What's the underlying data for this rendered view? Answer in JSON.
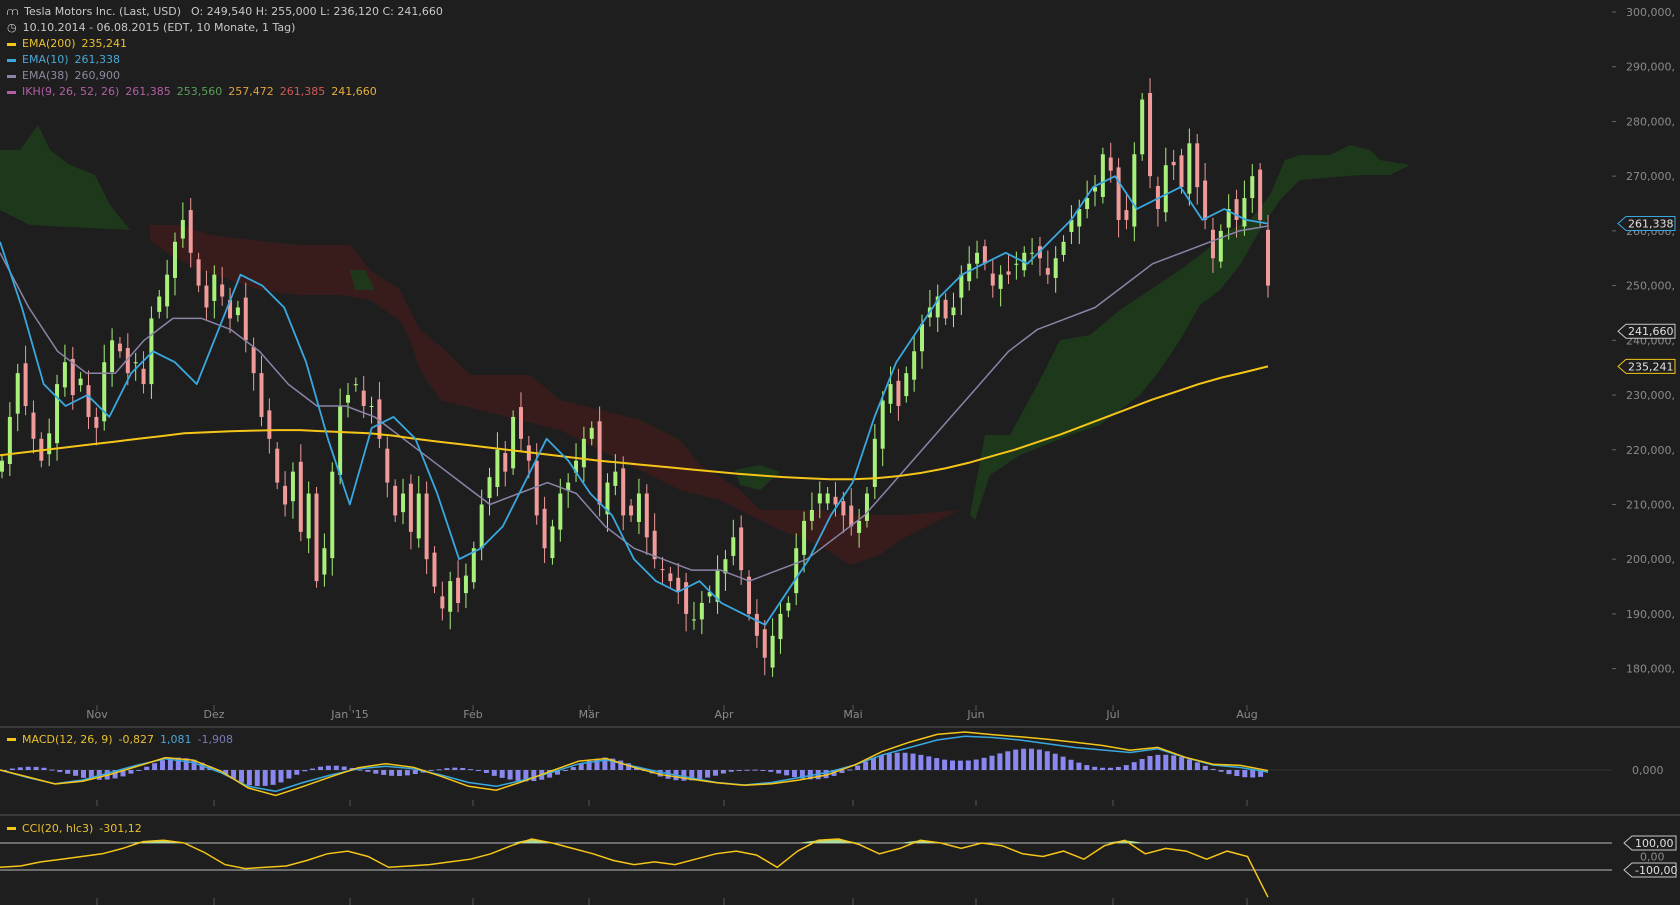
{
  "header": {
    "symbol": "Tesla Motors Inc. (Last, USD)",
    "ohlc": "O: 249,540   H: 255,000   L: 236,120   C: 241,660",
    "range": "10.10.2014 - 06.08.2015 (EDT, 10 Monate, 1 Tag)",
    "ema200": {
      "label": "EMA(200)",
      "value": "235,241"
    },
    "ema10": {
      "label": "EMA(10)",
      "value": "261,338"
    },
    "ema38": {
      "label": "EMA(38)",
      "value": "260,900"
    },
    "ikh": {
      "label": "IKH(9, 26, 52, 26)",
      "v1": "261,385",
      "v2": "253,560",
      "v3": "257,472",
      "v4": "261,385",
      "v5": "241,660"
    }
  },
  "macd_legend": {
    "label": "MACD(12, 26, 9)",
    "v1": "-0,827",
    "v2": "1,081",
    "v3": "-1,908"
  },
  "cci_legend": {
    "label": "CCI(20, hlc3)",
    "v1": "-301,12"
  },
  "colors": {
    "bg": "#1e1e1e",
    "grid": "#3a3a3a",
    "up": "#a8f07a",
    "down": "#f09a9a",
    "ema200": "#f5c518",
    "ema10": "#3aa8e0",
    "ema38": "#8a84a8",
    "cloud_green": "#1d3a1b",
    "cloud_red": "#3a1c1c",
    "macd_hist": "#8888ee",
    "cci_line": "#f5c518",
    "cci_up_fill": "#b9f0a0",
    "cci_down_fill": "#f0b0b0"
  },
  "chart_data": {
    "type": "line",
    "title": "Tesla Motors Inc. (Last, USD)",
    "x_tick_labels": [
      "Nov",
      "Dez",
      "Jan '15",
      "Feb",
      "Mär",
      "Apr",
      "Mai",
      "Jun",
      "Jul",
      "Aug"
    ],
    "y_tick_labels": [
      "300,000",
      "290,000",
      "280,000",
      "270,000",
      "260,000",
      "250,000",
      "240,000",
      "230,000",
      "220,000",
      "210,000",
      "200,000",
      "190,000",
      "180,000"
    ],
    "ylim": [
      175,
      300
    ],
    "price_tags": [
      {
        "label": "261,338",
        "value": 261.338,
        "color": "#3aa8e0"
      },
      {
        "label": "241,660",
        "value": 241.66,
        "color": "#c8c8c8"
      },
      {
        "label": "235,241",
        "value": 235.241,
        "color": "#f5c518"
      }
    ],
    "candles_close": [
      218,
      226,
      234,
      228,
      222,
      218,
      223,
      232,
      236,
      230,
      233,
      226,
      224,
      236,
      240,
      238,
      234,
      236,
      232,
      244,
      248,
      252,
      258,
      262,
      256,
      250,
      246,
      252,
      248,
      244,
      246,
      240,
      234,
      226,
      222,
      214,
      210,
      216,
      205,
      212,
      196,
      202,
      216,
      228,
      230,
      232,
      228,
      228,
      222,
      214,
      208,
      212,
      205,
      212,
      200,
      195,
      191,
      196,
      192,
      197,
      202,
      210,
      215,
      220,
      216,
      226,
      222,
      218,
      208,
      202,
      206,
      212,
      214,
      218,
      222,
      224,
      210,
      214,
      216,
      208,
      208,
      212,
      204,
      200,
      198,
      196,
      194,
      190,
      189,
      192,
      194,
      198,
      200,
      204,
      198,
      190,
      186,
      182,
      186,
      190,
      192,
      202,
      207,
      209,
      212,
      212,
      210,
      208,
      206,
      207,
      212,
      222,
      229,
      232,
      228,
      234,
      238,
      243,
      246,
      248,
      244,
      246,
      252,
      254,
      256,
      254,
      250,
      252,
      252,
      254,
      256,
      256,
      255,
      252,
      255,
      258,
      262,
      264,
      266,
      268,
      274,
      271,
      262,
      262,
      274,
      284,
      270,
      264,
      272,
      272,
      268,
      276,
      268,
      262,
      255,
      260,
      264,
      262,
      266,
      270,
      262,
      250
    ],
    "ema200": [
      219,
      219.5,
      220,
      220.5,
      221,
      221.5,
      222,
      222.5,
      223,
      223.2,
      223.4,
      223.5,
      223.6,
      223.6,
      223.4,
      223.2,
      223,
      222.6,
      222,
      221.5,
      221,
      220.5,
      220,
      219.5,
      219,
      218.5,
      218,
      217.6,
      217.2,
      216.8,
      216.4,
      216,
      215.6,
      215.3,
      215,
      214.8,
      214.6,
      214.6,
      214.8,
      215.2,
      215.8,
      216.6,
      217.6,
      218.8,
      220,
      221.4,
      222.8,
      224.4,
      226,
      227.6,
      229.2,
      230.6,
      232,
      233.2,
      234.2,
      235.241
    ],
    "ema10": [
      258,
      246,
      232,
      228,
      230,
      226,
      234,
      238,
      236,
      232,
      242,
      252,
      250,
      246,
      236,
      222,
      210,
      224,
      226,
      222,
      212,
      200,
      202,
      206,
      214,
      222,
      218,
      212,
      208,
      200,
      196,
      194,
      196,
      192,
      190,
      188,
      194,
      200,
      208,
      214,
      226,
      236,
      242,
      248,
      252,
      254,
      256,
      254,
      258,
      262,
      268,
      270,
      264,
      266,
      268,
      262,
      264,
      262,
      261.338
    ],
    "ema38": [
      256,
      246,
      238,
      234,
      234,
      240,
      244,
      244,
      242,
      238,
      232,
      228,
      228,
      226,
      222,
      218,
      214,
      210,
      212,
      214,
      212,
      206,
      202,
      200,
      198,
      198,
      196,
      198,
      200,
      204,
      208,
      214,
      220,
      226,
      232,
      238,
      242,
      244,
      246,
      250,
      254,
      256,
      258,
      260,
      260.9
    ],
    "macd": [
      0.0,
      -3.0,
      -5.5,
      -4.0,
      -1.0,
      2.0,
      4.5,
      3.0,
      -1.0,
      -6.5,
      -8.5,
      -5.0,
      -2.0,
      0.5,
      1.5,
      0.5,
      -2.0,
      -5.0,
      -6.5,
      -4.0,
      -1.0,
      2.5,
      4.0,
      1.5,
      -1.0,
      -3.0,
      -5.0,
      -6.0,
      -5.0,
      -3.0,
      -1.0,
      2.0,
      6.0,
      9.0,
      12.0,
      13.5,
      13.0,
      12.0,
      10.5,
      9.0,
      8.0,
      7.0,
      8.5,
      5.0,
      2.0,
      1.0,
      -0.827
    ],
    "cci": [
      -80,
      -70,
      -40,
      -20,
      0,
      20,
      60,
      110,
      120,
      100,
      30,
      -60,
      -90,
      -80,
      -70,
      -30,
      20,
      40,
      0,
      -80,
      -70,
      -60,
      -40,
      -20,
      20,
      80,
      130,
      100,
      60,
      20,
      -30,
      -60,
      -40,
      -60,
      -20,
      20,
      40,
      10,
      -80,
      40,
      120,
      130,
      90,
      20,
      60,
      120,
      100,
      60,
      100,
      80,
      20,
      0,
      40,
      -20,
      80,
      120,
      20,
      60,
      40,
      -20,
      40,
      0,
      -301.12
    ],
    "x_tick_labels_cci_macd": [
      "0,000",
      "100,00",
      "0,00",
      "-100,00"
    ]
  },
  "macd_axis": {
    "zero_label": "0,000"
  },
  "cci_axis": {
    "hi_label": "100,00",
    "mid_label": "0,00",
    "lo_label": "-100,00"
  }
}
